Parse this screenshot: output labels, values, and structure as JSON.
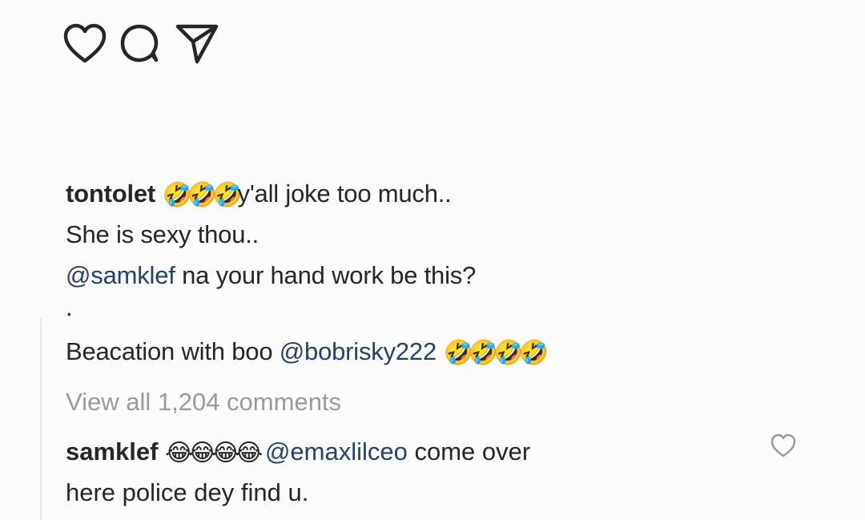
{
  "actions": {
    "like_icon": "heart-icon",
    "comment_icon": "comment-bubble-icon",
    "share_icon": "paper-plane-icon"
  },
  "caption": {
    "username": "tontolet",
    "emoji_1": "🤣🤣🤣",
    "line1_text": "y'all joke too much..",
    "line2_text": "She is sexy thou..",
    "mention_1": "@samklef",
    "line3_text": " na your hand work be this?",
    "dot": ".",
    "line5_text": "Beacation with boo ",
    "mention_2": "@bobrisky222",
    "emoji_2": "🤣🤣🤣🤣"
  },
  "comments_link": "View all 1,204 comments",
  "comment": {
    "username": "samklef",
    "emoji": "😂😂😂😂",
    "mention": "@emaxlilceo",
    "text_part1": " come over",
    "text_part2": "here police dey find u.",
    "like_icon": "heart-outline-icon"
  },
  "colors": {
    "text": "#262626",
    "mention": "#27416b",
    "muted": "#9a9a9a",
    "background": "#fbfbfb"
  }
}
